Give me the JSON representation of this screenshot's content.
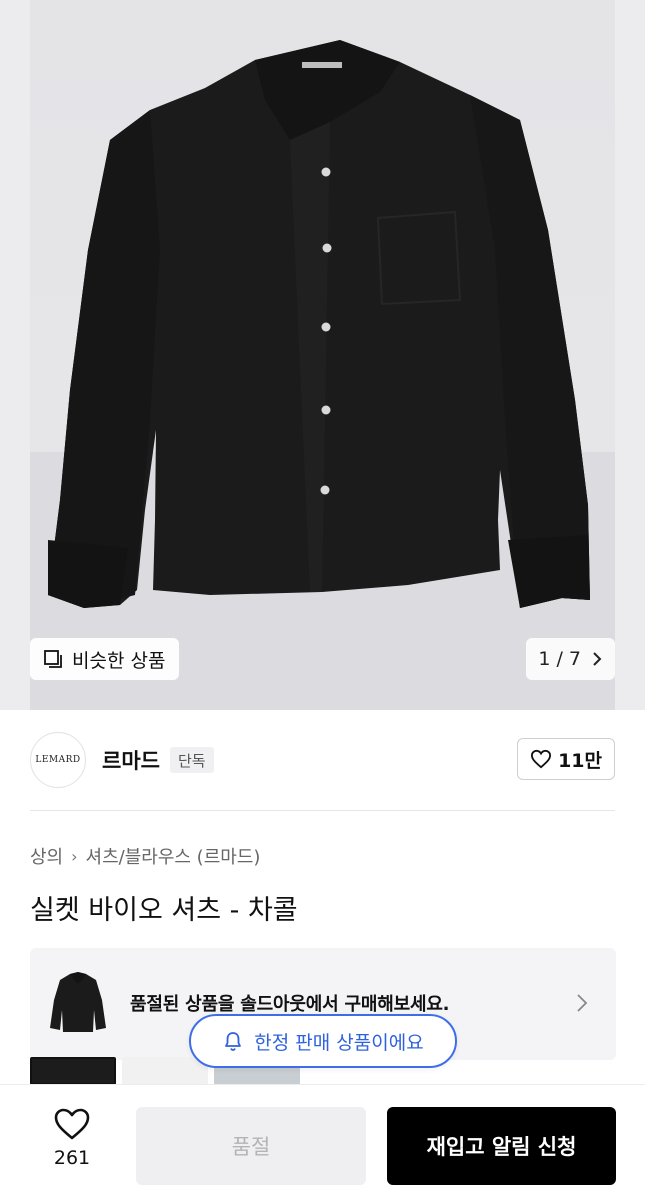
{
  "hero": {
    "similar_label": "비슷한 상품",
    "pager": "1 / 7",
    "icons": {
      "similar": "stacked-squares-icon",
      "pager": "chevron-right-icon"
    }
  },
  "brand": {
    "logo_text": "LEMARD",
    "name": "르마드",
    "badge": "단독",
    "like_count": "11만",
    "icons": {
      "like": "heart-outline-icon"
    }
  },
  "breadcrumb": {
    "category": "상의",
    "subcategory": "셔츠/블라우스 (르마드)"
  },
  "product": {
    "title": "실켓 바이오 셔츠 - 차콜"
  },
  "soldout_banner": {
    "text": "품절된 상품을 솔드아웃에서 구매해보세요.",
    "icons": {
      "chevron": "chevron-right-icon"
    }
  },
  "limited_notice": {
    "text": "한정 판매 상품이에요",
    "icons": {
      "bell": "bell-icon"
    },
    "color": "#2f62dd"
  },
  "bottom_bar": {
    "wish_count": "261",
    "soldout_label": "품절",
    "restock_label": "재입고 알림 신청",
    "icons": {
      "wish": "heart-outline-icon"
    }
  }
}
